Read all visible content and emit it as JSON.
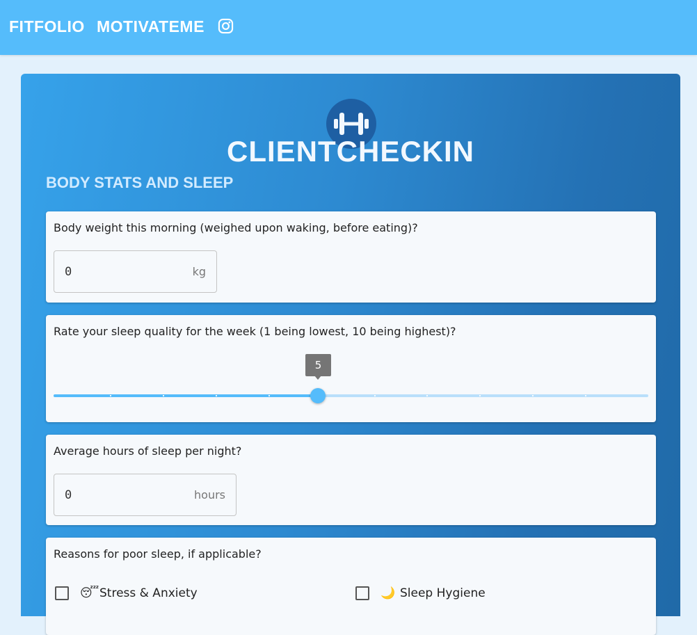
{
  "nav": {
    "links": [
      "FITFOLIO",
      "MOTIVATEME"
    ],
    "instagram_icon": "instagram-icon"
  },
  "card": {
    "logo_icon": "dumbbell-icon",
    "title": "CLIENTCHECKIN",
    "section_title": "BODY STATS AND SLEEP"
  },
  "questions": {
    "weight": {
      "label": "Body weight this morning (weighed upon waking, before eating)?",
      "value": "0",
      "unit": "kg"
    },
    "sleep_quality": {
      "label": "Rate your sleep quality for the week (1 being lowest, 10 being highest)?",
      "value": 5,
      "min": 1,
      "max": 10,
      "value_label": "5"
    },
    "sleep_hours": {
      "label": "Average hours of sleep per night?",
      "value": "0",
      "unit": "hours"
    },
    "poor_sleep": {
      "label": "Reasons for poor sleep, if applicable?",
      "options": [
        {
          "emoji": "😴",
          "label": "Stress & Anxiety",
          "checked": false
        },
        {
          "emoji": "🌙",
          "label": "Sleep Hygiene",
          "checked": false
        }
      ]
    }
  },
  "colors": {
    "navbar": "#55bcfb",
    "accent": "#55bcfb",
    "card_gradient_start": "#36a2ea",
    "card_gradient_end": "#206aa8"
  }
}
